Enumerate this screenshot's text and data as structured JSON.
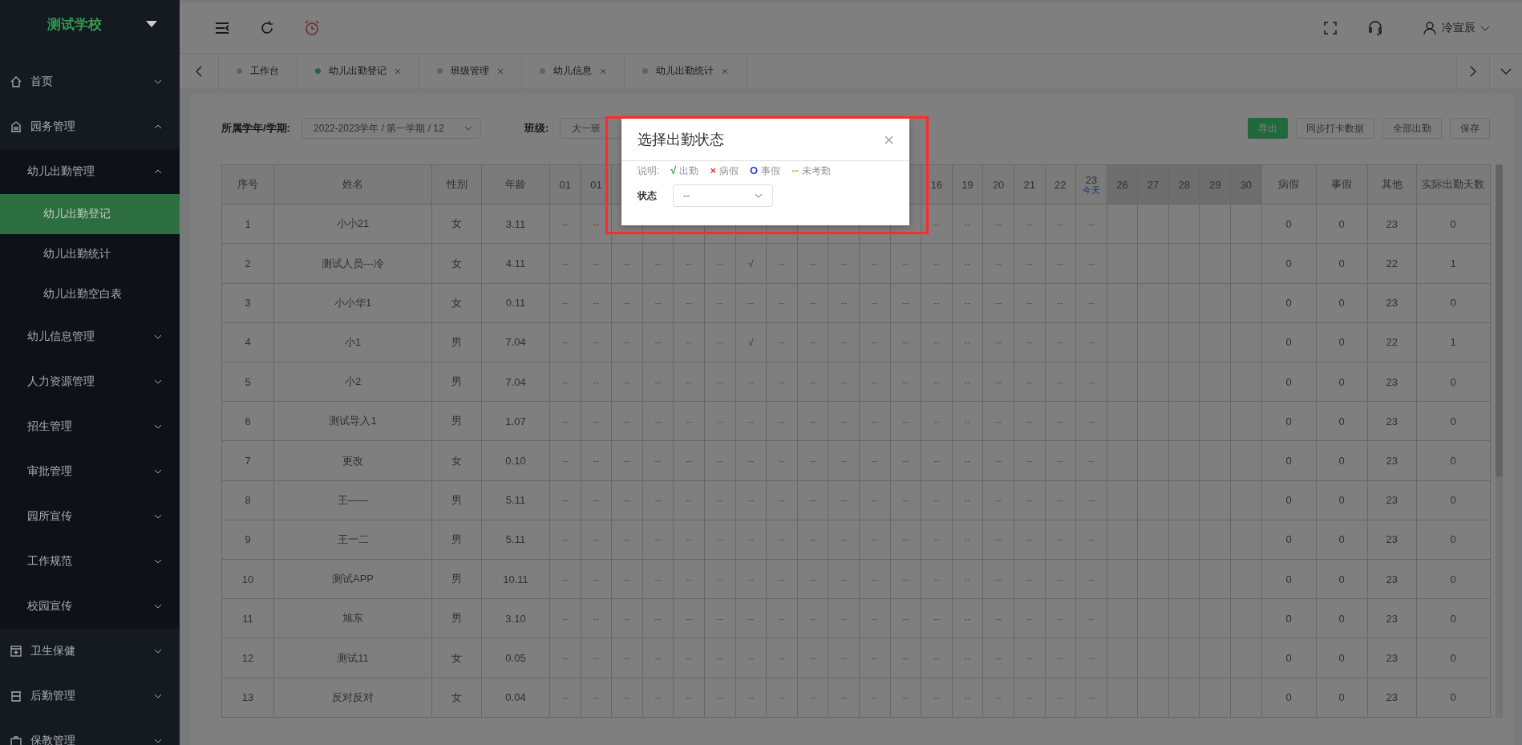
{
  "sidebar": {
    "logo": "测试学校",
    "menu": [
      {
        "label": "首页",
        "expanded": false
      },
      {
        "label": "园务管理",
        "expanded": true,
        "children": [
          {
            "label": "幼儿出勤管理",
            "expanded": true,
            "children": [
              {
                "label": "幼儿出勤登记",
                "selected": true
              },
              {
                "label": "幼儿出勤统计",
                "selected": false
              },
              {
                "label": "幼儿出勤空白表",
                "selected": false
              }
            ]
          },
          {
            "label": "幼儿信息管理",
            "expanded": false
          },
          {
            "label": "人力资源管理",
            "expanded": false
          },
          {
            "label": "招生管理",
            "expanded": false
          },
          {
            "label": "审批管理",
            "expanded": false
          },
          {
            "label": "园所宣传",
            "expanded": false
          },
          {
            "label": "工作规范",
            "expanded": false
          },
          {
            "label": "校园宣传",
            "expanded": false
          }
        ]
      },
      {
        "label": "卫生保健",
        "expanded": false
      },
      {
        "label": "后勤管理",
        "expanded": false
      },
      {
        "label": "保教管理",
        "expanded": false
      }
    ]
  },
  "header": {
    "user": "冷宣辰"
  },
  "tabs": [
    {
      "label": "工作台",
      "selected": false,
      "closable": false
    },
    {
      "label": "幼儿出勤登记",
      "selected": true,
      "closable": true
    },
    {
      "label": "班级管理",
      "selected": false,
      "closable": true
    },
    {
      "label": "幼儿信息",
      "selected": false,
      "closable": true
    },
    {
      "label": "幼儿出勤统计",
      "selected": false,
      "closable": true
    }
  ],
  "filters": [
    {
      "label": "所属学年/学期:",
      "value": "2022-2023学年 / 第一学期 / 12"
    },
    {
      "label": "班级:",
      "value": "大一班"
    }
  ],
  "actions": [
    {
      "label": "导出",
      "primary": true
    },
    {
      "label": "同步打卡数据",
      "primary": false
    },
    {
      "label": "全部出勤",
      "primary": false
    },
    {
      "label": "保存",
      "primary": false
    }
  ],
  "table": {
    "lead_columns": [
      "序号",
      "姓名",
      "性别",
      "年龄"
    ],
    "days_left": [
      {
        "label": "01",
        "future": false
      },
      {
        "label": "01",
        "future": false
      }
    ],
    "days_right": [
      {
        "label": "16",
        "future": false
      },
      {
        "label": "19",
        "future": false
      },
      {
        "label": "20",
        "future": false
      },
      {
        "label": "21",
        "future": false
      },
      {
        "label": "22",
        "future": false
      },
      {
        "label": "23",
        "today": "今天",
        "future": false
      },
      {
        "label": "26",
        "future": true
      },
      {
        "label": "27",
        "future": true
      },
      {
        "label": "28",
        "future": true
      },
      {
        "label": "29",
        "future": true
      },
      {
        "label": "30",
        "future": true
      }
    ],
    "tail_columns": [
      "病假",
      "事假",
      "其他",
      "实际出勤天数"
    ],
    "rows": [
      {
        "no": "1",
        "name": "小小21",
        "gender": "女",
        "age": "3.11",
        "days": [
          "--",
          "--",
          "--",
          "--",
          "--",
          "--",
          "--",
          "--"
        ],
        "totals": [
          "0",
          "0",
          "23",
          "0"
        ]
      },
      {
        "no": "2",
        "name": "测试人员---冷",
        "gender": "女",
        "age": "4.11",
        "days": [
          "--",
          "--",
          "--",
          "--",
          "--",
          "--",
          "√",
          "--",
          "--",
          "--",
          "--",
          "--",
          "--",
          "--",
          "--",
          "--",
          "--",
          "--"
        ],
        "totals": [
          "0",
          "0",
          "22",
          "1"
        ]
      },
      {
        "no": "3",
        "name": "小小华1",
        "gender": "女",
        "age": "0.11",
        "days": [
          "--",
          "--",
          "--",
          "--",
          "--",
          "--",
          "--",
          "--",
          "--",
          "--",
          "--",
          "--",
          "--",
          "--",
          "--",
          "--",
          "--",
          "--"
        ],
        "totals": [
          "0",
          "0",
          "23",
          "0"
        ]
      },
      {
        "no": "4",
        "name": "小1",
        "gender": "男",
        "age": "7.04",
        "days": [
          "--",
          "--",
          "--",
          "--",
          "--",
          "--",
          "√",
          "--",
          "--",
          "--",
          "--",
          "--",
          "--",
          "--",
          "--",
          "--",
          "--",
          "--"
        ],
        "totals": [
          "0",
          "0",
          "22",
          "1"
        ]
      },
      {
        "no": "5",
        "name": "小2",
        "gender": "男",
        "age": "7.04",
        "days": [
          "--",
          "--",
          "--",
          "--",
          "--",
          "--",
          "--",
          "--",
          "--",
          "--",
          "--",
          "--",
          "--",
          "--",
          "--",
          "--",
          "--",
          "--"
        ],
        "totals": [
          "0",
          "0",
          "23",
          "0"
        ]
      },
      {
        "no": "6",
        "name": "测试导入1",
        "gender": "男",
        "age": "1.07",
        "days": [
          "--",
          "--",
          "--",
          "--",
          "--",
          "--",
          "--",
          "--",
          "--",
          "--",
          "--",
          "--",
          "--",
          "--",
          "--",
          "--",
          "--",
          "--"
        ],
        "totals": [
          "0",
          "0",
          "23",
          "0"
        ]
      },
      {
        "no": "7",
        "name": "更改",
        "gender": "女",
        "age": "0.10",
        "days": [
          "--",
          "--",
          "--",
          "--",
          "--",
          "--",
          "--",
          "--",
          "--",
          "--",
          "--",
          "--",
          "--",
          "--",
          "--",
          "--",
          "--",
          "--"
        ],
        "totals": [
          "0",
          "0",
          "23",
          "0"
        ]
      },
      {
        "no": "8",
        "name": "王——",
        "gender": "男",
        "age": "5.11",
        "days": [
          "--",
          "--",
          "--",
          "--",
          "--",
          "--",
          "--",
          "--",
          "--",
          "--",
          "--",
          "--",
          "--",
          "--",
          "--",
          "--",
          "--",
          "--"
        ],
        "totals": [
          "0",
          "0",
          "23",
          "0"
        ]
      },
      {
        "no": "9",
        "name": "王一二",
        "gender": "男",
        "age": "5.11",
        "days": [
          "--",
          "--",
          "--",
          "--",
          "--",
          "--",
          "--",
          "--",
          "--",
          "--",
          "--",
          "--",
          "--",
          "--",
          "--",
          "--",
          "--",
          "--"
        ],
        "totals": [
          "0",
          "0",
          "23",
          "0"
        ]
      },
      {
        "no": "10",
        "name": "测试APP",
        "gender": "男",
        "age": "10.11",
        "days": [
          "--",
          "--",
          "--",
          "--",
          "--",
          "--",
          "--",
          "--",
          "--",
          "--",
          "--",
          "--",
          "--",
          "--",
          "--",
          "--",
          "--",
          "--"
        ],
        "totals": [
          "0",
          "0",
          "23",
          "0"
        ]
      },
      {
        "no": "11",
        "name": "旭东",
        "gender": "男",
        "age": "3.10",
        "days": [
          "--",
          "--",
          "--",
          "--",
          "--",
          "--",
          "--",
          "--",
          "--",
          "--",
          "--",
          "--",
          "--",
          "--",
          "--",
          "--",
          "--",
          "--"
        ],
        "totals": [
          "0",
          "0",
          "23",
          "0"
        ]
      },
      {
        "no": "12",
        "name": "测试11",
        "gender": "女",
        "age": "0.05",
        "days": [
          "--",
          "--",
          "--",
          "--",
          "--",
          "--",
          "--",
          "--",
          "--",
          "--",
          "--",
          "--",
          "--",
          "--",
          "--",
          "--",
          "--",
          "--"
        ],
        "totals": [
          "0",
          "0",
          "23",
          "0"
        ]
      },
      {
        "no": "13",
        "name": "反对反对",
        "gender": "女",
        "age": "0.04",
        "days": [
          "--",
          "--",
          "--",
          "--",
          "--",
          "--",
          "--",
          "--",
          "--",
          "--",
          "--",
          "--",
          "--",
          "--",
          "--",
          "--",
          "--",
          "--"
        ],
        "totals": [
          "0",
          "0",
          "23",
          "0"
        ]
      }
    ]
  },
  "dialog": {
    "title": "选择出勤状态",
    "legend_label": "说明:",
    "legend": [
      {
        "symbol": "√",
        "label": "出勤",
        "color": "#2e9e3e"
      },
      {
        "symbol": "×",
        "label": "病假",
        "color": "#e53935"
      },
      {
        "symbol": "O",
        "label": "事假",
        "color": "#2f3bd9"
      },
      {
        "symbol": "--",
        "label": "未考勤",
        "color": "#e6a23c"
      }
    ],
    "field_label": "状态",
    "field_value": "--"
  }
}
